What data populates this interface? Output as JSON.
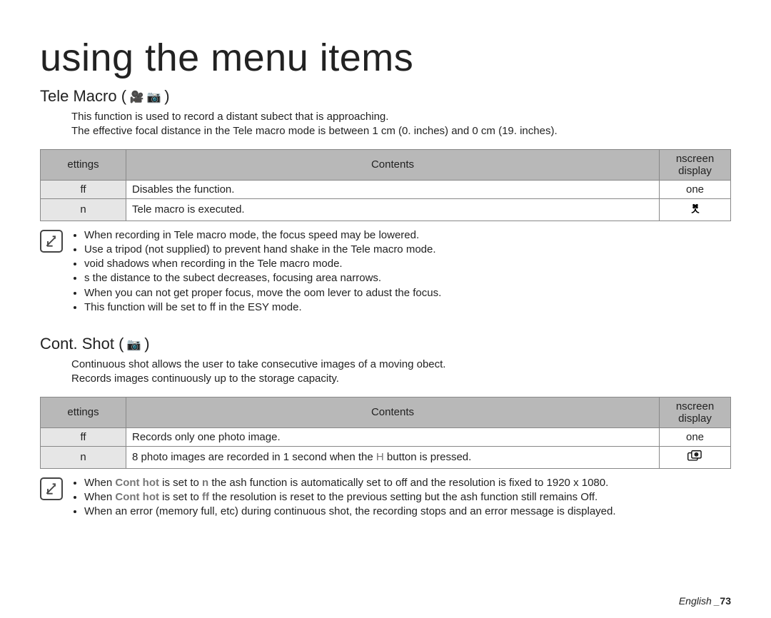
{
  "page_title": "using the menu items",
  "section1": {
    "title_label": "Tele Macro (",
    "title_close": ")",
    "icons_label": "video-icon camera-icon",
    "desc_line1": "This function is used to record a distant subect that is approaching.",
    "desc_line2": "The effective focal distance in the Tele macro mode is between 1 cm (0. inches) and 0 cm (19. inches).",
    "table": {
      "headers": {
        "settings": "ettings",
        "contents": "Contents",
        "display": "nscreen display"
      },
      "rows": [
        {
          "setting": "ff",
          "content": "Disables the function.",
          "display": "one"
        },
        {
          "setting": "n",
          "content": "Tele macro is executed.",
          "display_icon": "flower-icon"
        }
      ]
    },
    "notes": [
      "When recording in Tele macro mode, the focus speed may be lowered.",
      "Use a tripod (not supplied) to prevent hand shake in the Tele macro mode.",
      "void shadows when recording in the Tele macro mode.",
      "s the distance to the subect decreases, focusing area narrows.",
      "When you can not get proper focus, move the  oom  lever to adust the focus.",
      "This function will be set to  ff  in the ESY  mode."
    ]
  },
  "section2": {
    "title_label": "Cont. Shot (",
    "title_close": ")",
    "icons_label": "camera-icon",
    "desc_line1": "Continuous shot allows the user to take consecutive images of a moving obect.",
    "desc_line2": "Records images continuously up to the storage capacity.",
    "table": {
      "headers": {
        "settings": "ettings",
        "contents": "Contents",
        "display": "nscreen display"
      },
      "rows": [
        {
          "setting": "ff",
          "content": "Records only one photo image.",
          "display": "one"
        },
        {
          "setting": "n",
          "content_prefix": "8 photo images are recorded in 1 second when the  ",
          "content_mid": "H",
          "content_suffix": "  button is pressed.",
          "display_icon": "contshot-icon"
        }
      ]
    },
    "notes_rich": {
      "l1_pre": "When ",
      "l1_bold1": "Cont hot",
      "l1_mid": " is set to ",
      "l1_bold2": "n",
      "l1_post": "  the ash function is automatically set to off and the resolution is fixed to 1920 x 1080.",
      "l2_pre": "When ",
      "l2_bold1": "Cont hot",
      "l2_mid": " is set to ",
      "l2_bold2": "ff",
      "l2_post": "  the resolution is reset to the previous setting but the ash function still remains Off.",
      "l3": "When an error (memory full, etc) during continuous shot, the recording stops and an error message is displayed."
    }
  },
  "footer": {
    "lang": "English _",
    "page": "73"
  }
}
